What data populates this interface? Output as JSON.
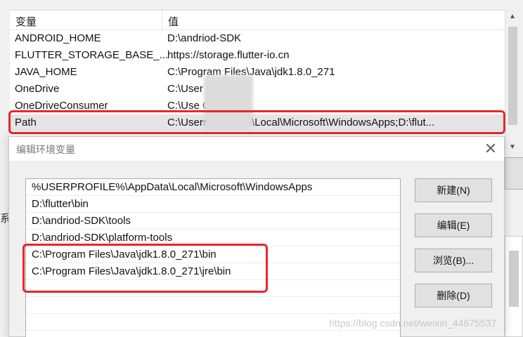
{
  "env_table": {
    "col_name": "变量",
    "col_value": "值",
    "rows": [
      {
        "name": "ANDROID_HOME",
        "value": "D:\\andriod-SDK"
      },
      {
        "name": "FLUTTER_STORAGE_BASE_...",
        "value": "https://storage.flutter-io.cn"
      },
      {
        "name": "JAVA_HOME",
        "value": "C:\\Program Files\\Java\\jdk1.8.0_271"
      },
      {
        "name": "OneDrive",
        "value": "C:\\User         OneDrive"
      },
      {
        "name": "OneDriveConsumer",
        "value": "C:\\Use          OneDrive"
      },
      {
        "name": "Path",
        "value": "C:\\Users        AppData\\Local\\Microsoft\\WindowsApps;D:\\flut..."
      }
    ],
    "left_partial_char": "系"
  },
  "dialog": {
    "title": "编辑环境变量",
    "close_glyph": "✕",
    "paths": [
      "%USERPROFILE%\\AppData\\Local\\Microsoft\\WindowsApps",
      "D:\\flutter\\bin",
      "D:\\andriod-SDK\\tools",
      "D:\\andriod-SDK\\platform-tools",
      "C:\\Program Files\\Java\\jdk1.8.0_271\\bin",
      "C:\\Program Files\\Java\\jdk1.8.0_271\\jre\\bin",
      "",
      "",
      ""
    ],
    "buttons": {
      "new": "新建(N)",
      "edit": "编辑(E)",
      "browse": "浏览(B)...",
      "delete": "删除(D)"
    }
  },
  "watermark": "https://blog.csdn.net/weixin_44675537",
  "colors": {
    "highlight": "#e8262b",
    "selected_row": "#e5e5e5"
  }
}
